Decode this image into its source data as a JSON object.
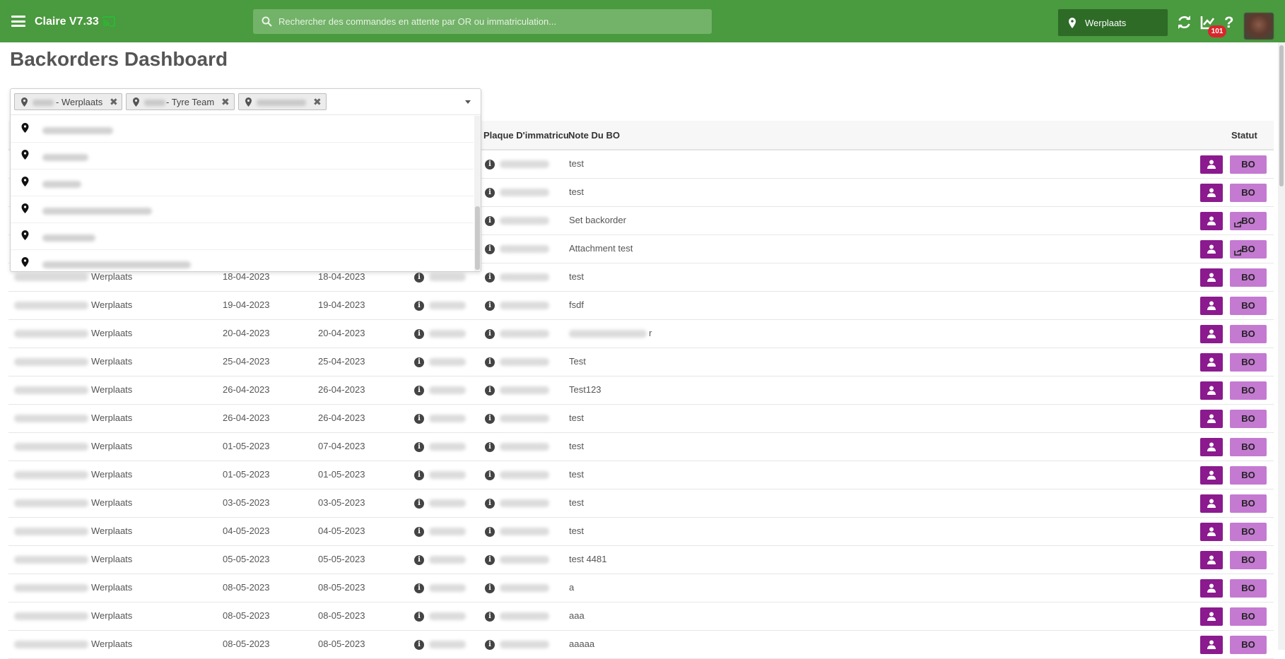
{
  "header": {
    "app_title": "Claire V7.33",
    "search_placeholder": "Rechercher des commandes en attente par OR ou immatriculation...",
    "location": "Werplaats",
    "notification_count": "101",
    "help_label": "?",
    "colors": {
      "bar": "#4a9a3f",
      "search": "#73b369",
      "location_bg": "#2d6b27",
      "badge": "#d9252c"
    },
    "icons": [
      "menu-icon",
      "cast-icon",
      "search-icon",
      "map-pin-icon",
      "refresh-icon",
      "chart-icon",
      "help-icon"
    ]
  },
  "page": {
    "title": "Backorders Dashboard"
  },
  "filter": {
    "chips": [
      {
        "label": "- Werplaats"
      },
      {
        "label": "- Tyre Team"
      },
      {
        "label": ""
      }
    ],
    "remove_symbol": "✖",
    "option_count": 6
  },
  "table": {
    "columns": {
      "plate": "Plaque D'immatricu",
      "note": "Note Du BO",
      "status": "Statut"
    },
    "rows": [
      {
        "location": "",
        "date1": "",
        "date2": "",
        "note": "test",
        "status": "BO",
        "linked": false
      },
      {
        "location": "",
        "date1": "",
        "date2": "",
        "note": "test",
        "status": "BO",
        "linked": false
      },
      {
        "location": "",
        "date1": "",
        "date2": "",
        "note": "Set backorder",
        "status": "BO",
        "linked": true
      },
      {
        "location": "",
        "date1": "",
        "date2": "",
        "note": "Attachment test",
        "status": "BO",
        "linked": true
      },
      {
        "location": "Werplaats",
        "date1": "18-04-2023",
        "date2": "18-04-2023",
        "note": "test",
        "status": "BO",
        "linked": false
      },
      {
        "location": "Werplaats",
        "date1": "19-04-2023",
        "date2": "19-04-2023",
        "note": "fsdf",
        "status": "BO",
        "linked": false
      },
      {
        "location": "Werplaats",
        "date1": "20-04-2023",
        "date2": "20-04-2023",
        "note": "r",
        "status": "BO",
        "linked": false
      },
      {
        "location": "Werplaats",
        "date1": "25-04-2023",
        "date2": "25-04-2023",
        "note": "Test",
        "status": "BO",
        "linked": false
      },
      {
        "location": "Werplaats",
        "date1": "26-04-2023",
        "date2": "26-04-2023",
        "note": "Test123",
        "status": "BO",
        "linked": false
      },
      {
        "location": "Werplaats",
        "date1": "26-04-2023",
        "date2": "26-04-2023",
        "note": "test",
        "status": "BO",
        "linked": false
      },
      {
        "location": "Werplaats",
        "date1": "01-05-2023",
        "date2": "07-04-2023",
        "note": "test",
        "status": "BO",
        "linked": false
      },
      {
        "location": "Werplaats",
        "date1": "01-05-2023",
        "date2": "01-05-2023",
        "note": "test",
        "status": "BO",
        "linked": false
      },
      {
        "location": "Werplaats",
        "date1": "03-05-2023",
        "date2": "03-05-2023",
        "note": "test",
        "status": "BO",
        "linked": false
      },
      {
        "location": "Werplaats",
        "date1": "04-05-2023",
        "date2": "04-05-2023",
        "note": "test",
        "status": "BO",
        "linked": false
      },
      {
        "location": "Werplaats",
        "date1": "05-05-2023",
        "date2": "05-05-2023",
        "note": "test 4481",
        "status": "BO",
        "linked": false
      },
      {
        "location": "Werplaats",
        "date1": "08-05-2023",
        "date2": "08-05-2023",
        "note": "a",
        "status": "BO",
        "linked": false
      },
      {
        "location": "Werplaats",
        "date1": "08-05-2023",
        "date2": "08-05-2023",
        "note": "aaa",
        "status": "BO",
        "linked": false
      },
      {
        "location": "Werplaats",
        "date1": "08-05-2023",
        "date2": "08-05-2023",
        "note": "aaaaa",
        "status": "BO",
        "linked": false
      }
    ],
    "colors": {
      "user_button": "#8b1a8f",
      "bo_button": "#c47ad1"
    }
  }
}
